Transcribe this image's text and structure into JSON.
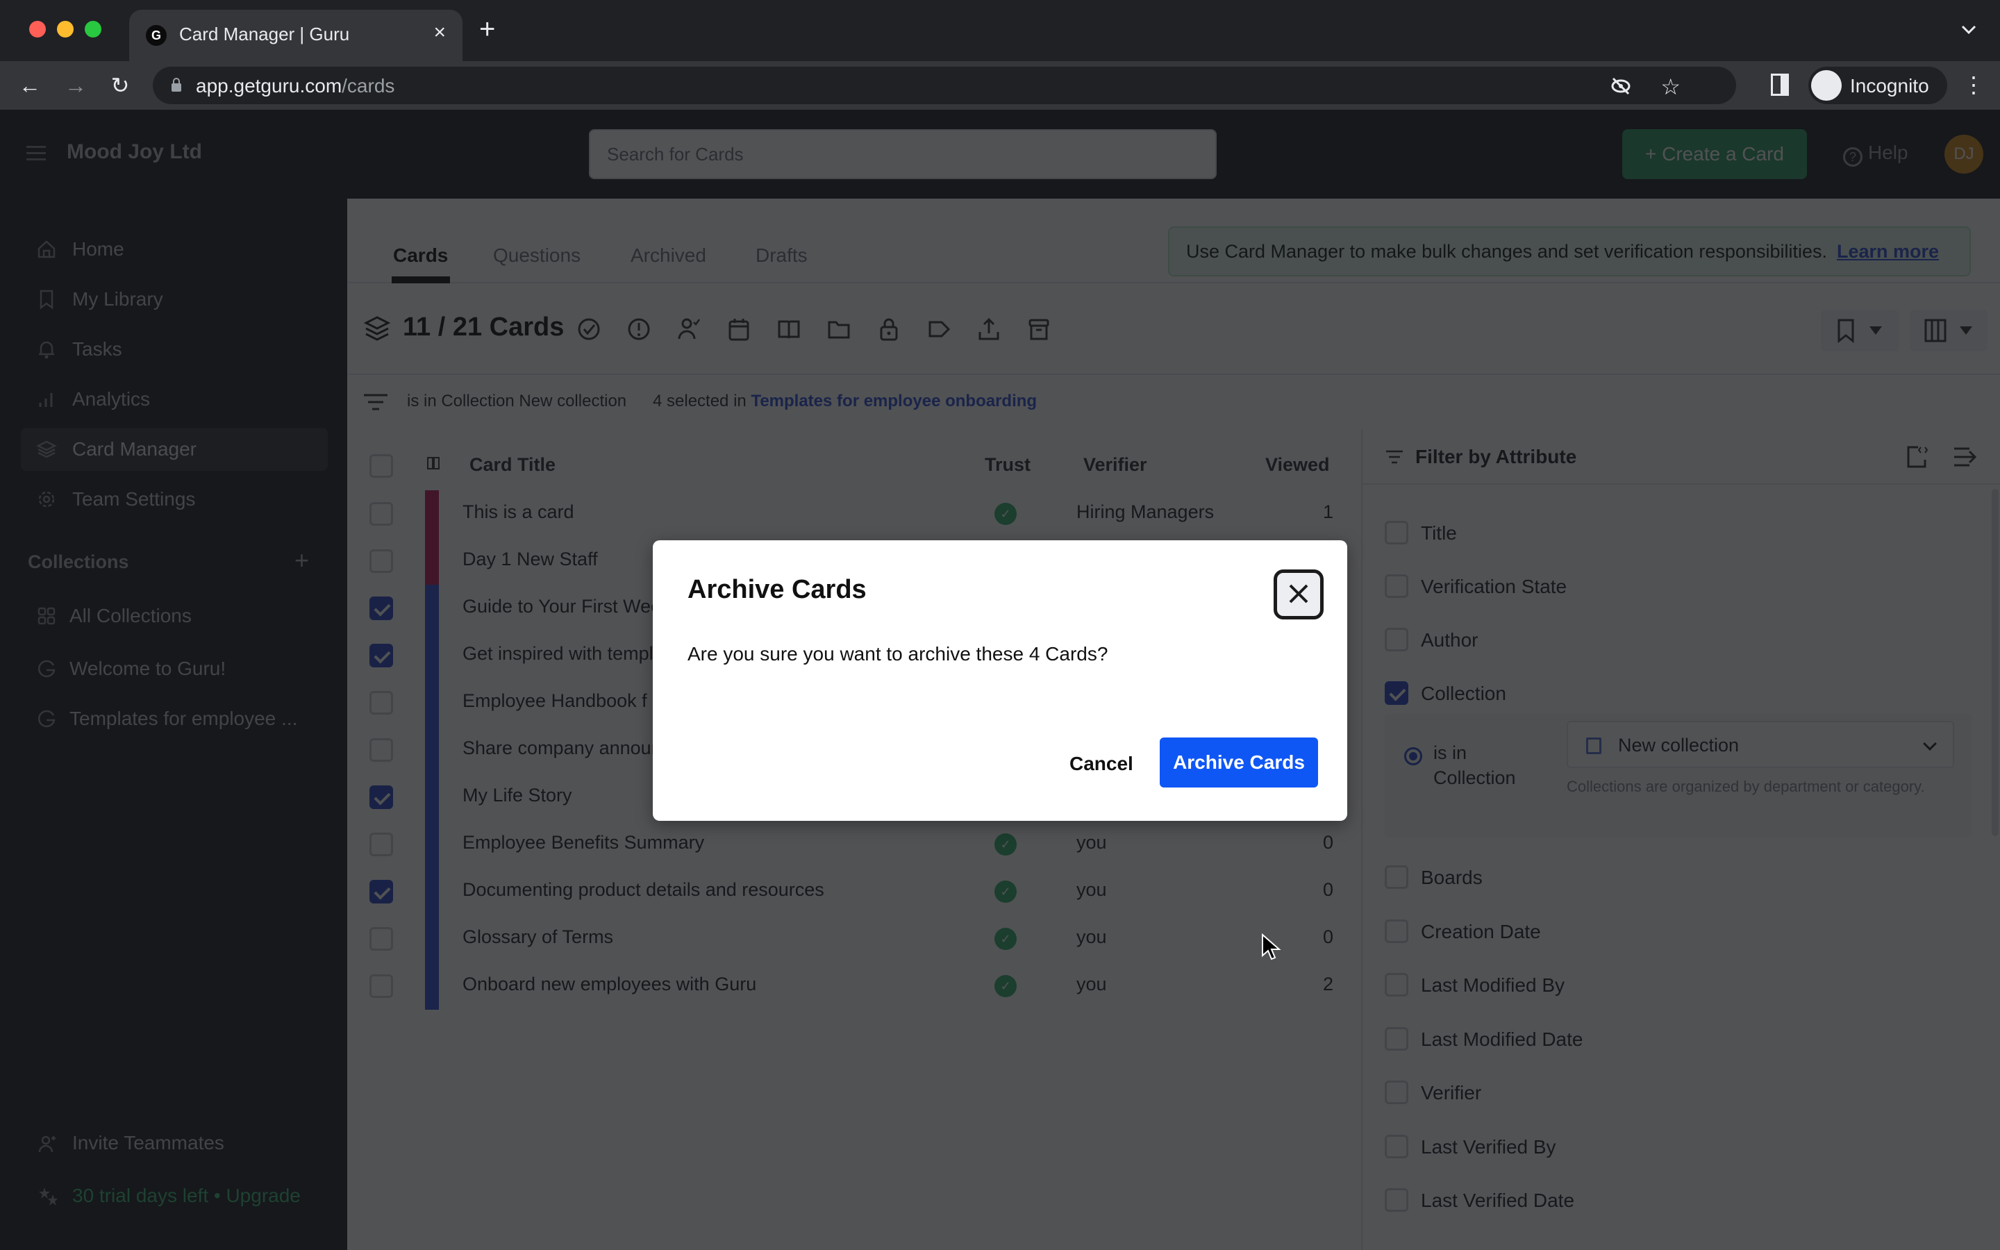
{
  "browser": {
    "tab_title": "Card Manager | Guru",
    "tab_favicon": "G",
    "tab_close": "×",
    "new_tab": "+",
    "url_host": "app.getguru.com",
    "url_path": "/cards",
    "profile_label": "Incognito",
    "kebab": "⋮",
    "star": "☆",
    "back": "←",
    "forward": "→",
    "reload": "↻"
  },
  "header": {
    "org_name": "Mood Joy Ltd",
    "search_placeholder": "Search for Cards",
    "create_button": "+ Create a Card",
    "help_label": "Help",
    "help_glyph": "?",
    "avatar_initials": "DJ"
  },
  "sidebar": {
    "items": [
      {
        "label": "Home",
        "icon": "home-icon"
      },
      {
        "label": "My Library",
        "icon": "bookmark-icon"
      },
      {
        "label": "Tasks",
        "icon": "bell-icon"
      },
      {
        "label": "Analytics",
        "icon": "bar-chart-icon"
      },
      {
        "label": "Card Manager",
        "icon": "layers-icon",
        "active": true
      },
      {
        "label": "Team Settings",
        "icon": "gear-icon"
      }
    ],
    "collections_header": "Collections",
    "collections_add": "+",
    "collections": [
      {
        "label": "All Collections",
        "icon": "grid-icon"
      },
      {
        "label": "Welcome to Guru!",
        "icon": "guru-icon"
      },
      {
        "label": "Templates for employee ...",
        "icon": "guru-icon"
      }
    ],
    "invite": "Invite Teammates",
    "trial": "30 trial days left • Upgrade"
  },
  "main": {
    "tabs": [
      {
        "label": "Cards",
        "active": true
      },
      {
        "label": "Questions"
      },
      {
        "label": "Archived"
      },
      {
        "label": "Drafts"
      }
    ],
    "banner_text": "Use Card Manager to make bulk changes and set verification responsibilities.",
    "banner_link": "Learn more",
    "card_count": "11 / 21 Cards",
    "toolbar_icons": [
      "verify-icon",
      "unverify-icon",
      "assign-verifier-icon",
      "calendar-icon",
      "book-icon",
      "folder-icon",
      "lock-icon",
      "tag-icon",
      "export-icon",
      "archive-icon"
    ],
    "filter_text": "is in Collection New collection",
    "selection_prefix": "4 selected in",
    "selection_collection": "Templates for employee onboarding"
  },
  "table": {
    "columns": {
      "title": "Card Title",
      "trust": "Trust",
      "verifier": "Verifier",
      "viewed": "Viewed"
    },
    "rows": [
      {
        "title": "This is a card",
        "checked": false,
        "bar": "magenta",
        "trusted": true,
        "verifier": "Hiring Managers",
        "viewed": "1"
      },
      {
        "title": "Day 1 New Staff",
        "checked": false,
        "bar": "magenta",
        "trusted": true,
        "verifier": "",
        "viewed": ""
      },
      {
        "title": "Guide to Your First Week",
        "checked": true,
        "bar": "blue",
        "trusted": true,
        "verifier": "",
        "viewed": ""
      },
      {
        "title": "Get inspired with templates",
        "checked": true,
        "bar": "blue",
        "trusted": true,
        "verifier": "",
        "viewed": ""
      },
      {
        "title": "Employee Handbook f",
        "checked": false,
        "bar": "blue",
        "trusted": true,
        "verifier": "",
        "viewed": ""
      },
      {
        "title": "Share company announcements",
        "checked": false,
        "bar": "blue",
        "trusted": true,
        "verifier": "",
        "viewed": ""
      },
      {
        "title": "My Life Story",
        "checked": true,
        "bar": "blue",
        "trusted": true,
        "verifier": "",
        "viewed": ""
      },
      {
        "title": "Employee Benefits Summary",
        "checked": false,
        "bar": "blue",
        "trusted": true,
        "verifier": "you",
        "viewed": "0"
      },
      {
        "title": "Documenting product details and resources",
        "checked": true,
        "bar": "blue",
        "trusted": true,
        "verifier": "you",
        "viewed": "0"
      },
      {
        "title": "Glossary of Terms",
        "checked": false,
        "bar": "blue",
        "trusted": true,
        "verifier": "you",
        "viewed": "0"
      },
      {
        "title": "Onboard new employees with Guru",
        "checked": false,
        "bar": "blue",
        "trusted": true,
        "verifier": "you",
        "viewed": "2"
      }
    ],
    "check_glyph": "✓"
  },
  "filter_panel": {
    "title": "Filter by Attribute",
    "attributes_top": [
      {
        "label": "Title",
        "checked": false
      },
      {
        "label": "Verification State",
        "checked": false
      },
      {
        "label": "Author",
        "checked": false
      },
      {
        "label": "Collection",
        "checked": true
      }
    ],
    "collection_condition": "is in Collection",
    "collection_value": "New collection",
    "collection_help": "Collections are organized by department or category.",
    "attributes_bottom": [
      {
        "label": "Boards",
        "checked": false
      },
      {
        "label": "Creation Date",
        "checked": false
      },
      {
        "label": "Last Modified By",
        "checked": false
      },
      {
        "label": "Last Modified Date",
        "checked": false
      },
      {
        "label": "Verifier",
        "checked": false
      },
      {
        "label": "Last Verified By",
        "checked": false
      },
      {
        "label": "Last Verified Date",
        "checked": false
      }
    ]
  },
  "modal": {
    "title": "Archive Cards",
    "body": "Are you sure you want to archive these 4 Cards?",
    "cancel": "Cancel",
    "confirm": "Archive Cards"
  },
  "colors": {
    "accent_blue": "#0f57f5",
    "create_green": "#2b9c61",
    "bar_magenta": "#c2185b",
    "bar_blue": "#2f4fd6",
    "trust_green": "#2fb36b"
  }
}
